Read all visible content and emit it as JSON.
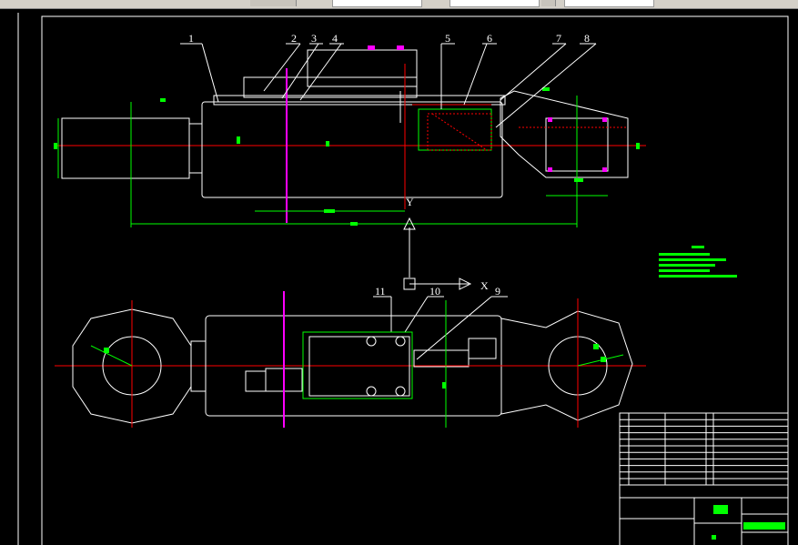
{
  "toolbar": {
    "fields": [
      "",
      "",
      "",
      ""
    ]
  },
  "drawing": {
    "part_numbers": [
      "1",
      "2",
      "3",
      "4",
      "5",
      "6",
      "7",
      "8",
      "9",
      "10",
      "11"
    ],
    "view_arrow_x": "X",
    "view_arrow_y": "Y"
  },
  "colors": {
    "background": "#000000",
    "outline": "#ffffff",
    "centerline": "#ff0000",
    "dimension": "#00ff00",
    "hatch": "#ff00ff",
    "background_ui": "#d4d0c8"
  }
}
